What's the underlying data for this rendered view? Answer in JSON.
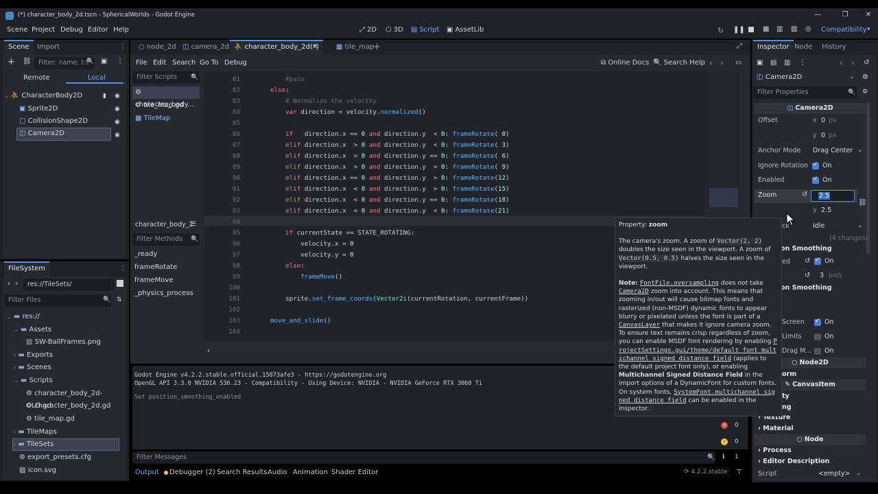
{
  "window": {
    "title": "(*) character_body_2d.tscn - SphericalWorlds - Godot Engine"
  },
  "menu": [
    "Scene",
    "Project",
    "Debug",
    "Editor",
    "Help"
  ],
  "workspaces": [
    {
      "label": "2D",
      "active": false
    },
    {
      "label": "3D",
      "active": false
    },
    {
      "label": "Script",
      "active": true
    },
    {
      "label": "AssetLib",
      "active": false
    }
  ],
  "renderer": "Compatibility",
  "scene_panel": {
    "tabs": [
      "Scene",
      "Import"
    ],
    "filter_placeholder": "Filter: name, t:t",
    "remote": "Remote",
    "local": "Local",
    "nodes": [
      "CharacterBody2D",
      "Sprite2D",
      "CollisionShape2D",
      "Camera2D"
    ]
  },
  "filesystem": {
    "title": "FileSystem",
    "path": "res://TileSets/",
    "filter_placeholder": "Filter Files",
    "items": [
      {
        "label": "res://",
        "depth": 0
      },
      {
        "label": "Assets",
        "depth": 1
      },
      {
        "label": "SW-BallFrames.png",
        "depth": 2
      },
      {
        "label": "Exports",
        "depth": 1
      },
      {
        "label": "Scenes",
        "depth": 1
      },
      {
        "label": "Scripts",
        "depth": 1
      },
      {
        "label": "character_body_2d-OLD.gd",
        "depth": 2
      },
      {
        "label": "character_body_2d.gd",
        "depth": 2
      },
      {
        "label": "tile_map.gd",
        "depth": 2
      },
      {
        "label": "TileMaps",
        "depth": 1
      },
      {
        "label": "TileSets",
        "depth": 1
      },
      {
        "label": "export_presets.cfg",
        "depth": 1
      },
      {
        "label": "icon.svg",
        "depth": 1
      }
    ]
  },
  "editor_tabs": [
    "node_2d",
    "camera_2d",
    "character_body_2d(*)",
    "tile_map"
  ],
  "script_menu": [
    "File",
    "Edit",
    "Search",
    "Go To",
    "Debug"
  ],
  "script_toolbar": {
    "online_docs": "Online Docs",
    "search_help": "Search Help"
  },
  "scripts_panel": {
    "filter_placeholder": "Filter Scripts",
    "scripts": [
      "character_body...",
      "tile_map.gd",
      "TileMap"
    ],
    "current": "character_body_2",
    "methods_placeholder": "Filter Methods",
    "methods": [
      "_ready",
      "frameRotate",
      "frameMove",
      "_physics_process"
    ]
  },
  "code": {
    "lines": [
      {
        "n": "81",
        "t": "    #pass"
      },
      {
        "n": "82",
        "t": "else:"
      },
      {
        "n": "83",
        "t": "    # Normalize the velocity"
      },
      {
        "n": "84",
        "t": "    var direction = velocity.normalized()"
      },
      {
        "n": "85",
        "t": ""
      },
      {
        "n": "86",
        "t": "    if   direction.x == 0 and direction.y  < 0: frameRotate( 0)"
      },
      {
        "n": "87",
        "t": "    elif direction.x  > 0 and direction.y  < 0: frameRotate( 3)"
      },
      {
        "n": "88",
        "t": "    elif direction.x  > 0 and direction.y == 0: frameRotate( 6)"
      },
      {
        "n": "89",
        "t": "    elif direction.x  > 0 and direction.y  > 0: frameRotate( 9)"
      },
      {
        "n": "90",
        "t": "    elif direction.x == 0 and direction.y  > 0: frameRotate(12)"
      },
      {
        "n": "91",
        "t": "    elif direction.x  < 0 and direction.y  > 0: frameRotate(15)"
      },
      {
        "n": "92",
        "t": "    elif direction.x  < 0 and direction.y == 0: frameRotate(18)"
      },
      {
        "n": "93",
        "t": "    elif direction.x  < 0 and direction.y  < 0: frameRotate(21)"
      },
      {
        "n": "94",
        "t": ""
      },
      {
        "n": "95",
        "t": "    if currentState == STATE_ROTATING:"
      },
      {
        "n": "96",
        "t": "        velocity.x = 0"
      },
      {
        "n": "97",
        "t": "        velocity.y = 0"
      },
      {
        "n": "98",
        "t": "    else:"
      },
      {
        "n": "99",
        "t": "        frameMove()"
      },
      {
        "n": "100",
        "t": ""
      },
      {
        "n": "101",
        "t": "    sprite.set_frame_coords(Vector2i(currentRotation, currentFrame))"
      },
      {
        "n": "102",
        "t": ""
      },
      {
        "n": "103",
        "t": "move_and_slide()"
      },
      {
        "n": "104",
        "t": ""
      }
    ]
  },
  "output": {
    "lines": [
      "Godot Engine v4.2.2.stable.official.15073afe3 - https://godotengine.org",
      "OpenGL API 3.3.0 NVIDIA 536.23 - Compatibility - Using Device: NVIDIA - NVIDIA GeForce RTX 3060 Ti",
      "",
      "Set position_smoothing_enabled"
    ],
    "filter_placeholder": "Filter Messages",
    "counts": {
      "errors": "0",
      "warnings": "0",
      "messages": "1"
    }
  },
  "bottom_tabs": [
    "Output",
    "Debugger (2)",
    "Search Results",
    "Audio",
    "Animation",
    "Shader Editor"
  ],
  "version": "4.2.2.stable",
  "inspector": {
    "tabs": [
      "Inspector",
      "Node",
      "History"
    ],
    "object": "Camera2D",
    "filter_placeholder": "Filter Properties",
    "class_header": "Camera2D",
    "offset_label": "Offset",
    "offset_x": "0",
    "offset_y": "0",
    "px": "px",
    "anchor_mode_label": "Anchor Mode",
    "anchor_mode": "Drag Center",
    "ignore_rotation_label": "Ignore Rotation",
    "enabled_label": "Enabled",
    "on": "On",
    "zoom_label": "Zoom",
    "zoom_x": "2.5",
    "zoom_y": "2.5",
    "process_callback_label": "ck",
    "process_callback": "Idle",
    "changes": "(4 changes)",
    "pos_smoothing": "on Smoothing",
    "enabled_partial": "ed",
    "speed_value": "3",
    "speed_unit": "px/s",
    "rot_smoothing": "on Smoothing",
    "screen_label": "Screen",
    "limits_label": "Limits",
    "dragm_label": "Drag M...",
    "node2d": "Node2D",
    "transform_partial": "orm",
    "canvasitem": "CanvasItem",
    "visibility_partial": "ty",
    "ordering_partial": "ng",
    "texture": "Texture",
    "material": "Material",
    "node": "Node",
    "process": "Process",
    "editor_description": "Editor Description",
    "script_label": "Script",
    "script_value": "<empty>"
  },
  "tooltip": {
    "heading_prefix": "Property: ",
    "heading_name": "zoom",
    "p1a": "The camera's zoom. A zoom of ",
    "p1b": "Vector(2, 2)",
    "p1c": " doubles the size seen in the viewport. A zoom of ",
    "p1d": "Vector(0.5, 0.5)",
    "p1e": " halves the size seen in the viewport.",
    "note_label": "Note:",
    "n1": "FontFile.oversampling",
    "n2": " does ",
    "n3": "not",
    "n4": " take ",
    "n5": "Camera2D",
    "n6": " zoom into account. This means that zooming in/out will cause bitmap fonts and rasterized (non-MSDF) dynamic fonts to appear blurry or pixelated unless the font is part of a ",
    "n7": "CanvasLayer",
    "n8": " that makes it ignore camera zoom. To ensure text remains crisp regardless of zoom, you can enable MSDF font rendering by enabling ",
    "n9": "ProjectSettings.gui/theme/default_font_multichannel_signed_distance_field",
    "n10": " (applies to the default project font only), or enabling ",
    "n11": "Multichannel Signed Distance Field",
    "n12": " in the import options of a DynamicFont for custom fonts. On system fonts, ",
    "n13": "SystemFont.multichannel_signed_distance_field",
    "n14": " can be enabled in the inspector."
  }
}
